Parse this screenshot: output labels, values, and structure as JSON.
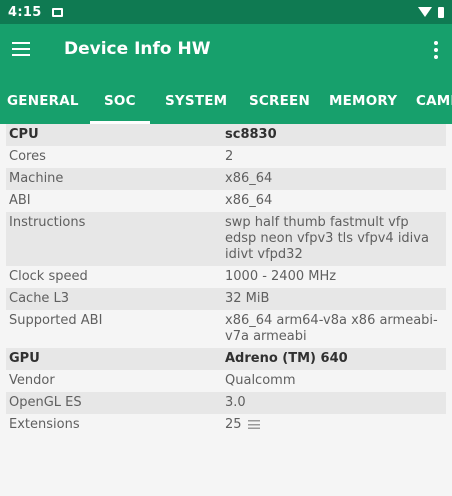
{
  "status_bar": {
    "time": "4:15"
  },
  "app_bar": {
    "title": "Device Info HW"
  },
  "tabs": [
    {
      "label": "GENERAL",
      "active": false
    },
    {
      "label": "SOC",
      "active": true
    },
    {
      "label": "SYSTEM",
      "active": false
    },
    {
      "label": "SCREEN",
      "active": false
    },
    {
      "label": "MEMORY",
      "active": false
    },
    {
      "label": "CAME",
      "active": false
    }
  ],
  "soc": {
    "cpu": {
      "label": "CPU",
      "value": "sc8830"
    },
    "cores": {
      "label": "Cores",
      "value": "2"
    },
    "machine": {
      "label": "Machine",
      "value": "x86_64"
    },
    "abi": {
      "label": "ABI",
      "value": "x86_64"
    },
    "instructions": {
      "label": "Instructions",
      "value": "swp half thumb fastmult vfp edsp neon vfpv3 tls vfpv4 idiva idivt vfpd32"
    },
    "clock_speed": {
      "label": "Clock speed",
      "value": "1000 - 2400 MHz"
    },
    "cache_l3": {
      "label": "Cache L3",
      "value": "32 MiB"
    },
    "supported_abi": {
      "label": "Supported ABI",
      "value": "x86_64 arm64-v8a x86 armeabi-v7a armeabi"
    },
    "gpu": {
      "label": "GPU",
      "value": "Adreno (TM) 640"
    },
    "vendor": {
      "label": "Vendor",
      "value": "Qualcomm"
    },
    "opengl_es": {
      "label": "OpenGL ES",
      "value": "3.0"
    },
    "extensions": {
      "label": "Extensions",
      "value": "25"
    }
  }
}
